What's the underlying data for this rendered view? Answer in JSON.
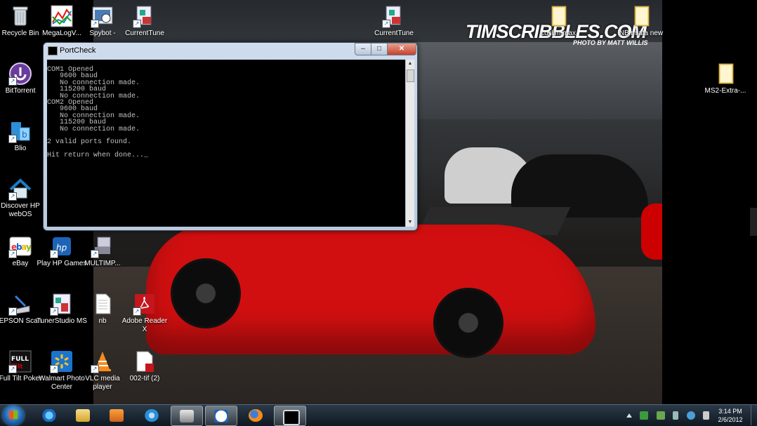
{
  "wallpaper": {
    "brand": "TIMSCRIBBLES.COM",
    "credit": "PHOTO BY MATT WILLIS"
  },
  "desktop_icons": [
    {
      "label": "Recycle Bin"
    },
    {
      "label": "MegaLogV..."
    },
    {
      "label": "Spybot -"
    },
    {
      "label": "CurrentTune"
    },
    {
      "label": "CurrentTune"
    },
    {
      "label": "cuslim max"
    },
    {
      "label": "NB miata new"
    },
    {
      "label": "BitTorrent"
    },
    {
      "label": "MS2-Extra-..."
    },
    {
      "label": "Blio"
    },
    {
      "label": "Discover HP webOS"
    },
    {
      "label": "eBay"
    },
    {
      "label": "Play HP Games"
    },
    {
      "label": "MULTIMP..."
    },
    {
      "label": "EPSON Scan"
    },
    {
      "label": "TunerStudio MS"
    },
    {
      "label": "nb"
    },
    {
      "label": "Adobe Reader X"
    },
    {
      "label": "Full Tilt Poker"
    },
    {
      "label": "Walmart Photo Center"
    },
    {
      "label": "VLC media player"
    },
    {
      "label": "002-tif (2)"
    }
  ],
  "window": {
    "title": "PortCheck",
    "buttons": {
      "min": "–",
      "max": "□",
      "close": "✕"
    },
    "console_text": "COM1 Opened\n   9600 baud\n   No connection made.\n   115200 baud\n   No connection made.\nCOM2 Opened\n   9600 baud\n   No connection made.\n   115200 baud\n   No connection made.\n\n2 valid ports found.\n\nHit return when done..._"
  },
  "taskbar": {
    "items": [
      "start",
      "internet-explorer",
      "windows-explorer",
      "media-player",
      "browser-orb",
      "printer",
      "hp",
      "firefox",
      "console"
    ],
    "clock_time": "3:14 PM",
    "clock_date": "2/6/2012"
  }
}
